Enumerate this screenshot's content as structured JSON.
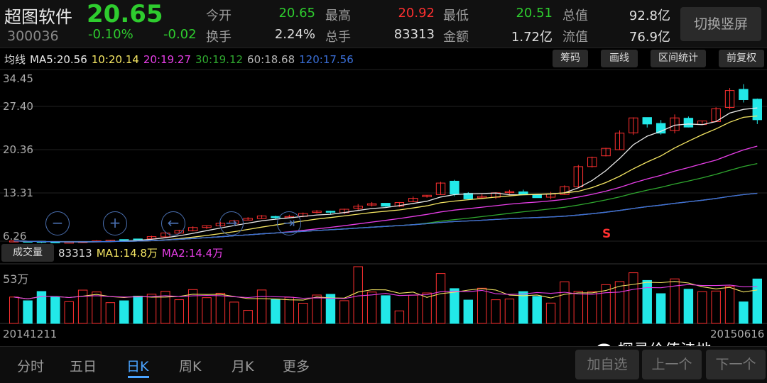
{
  "header": {
    "name": "超图软件",
    "price": "20.65",
    "code": "300036",
    "change_pct": "-0.10%",
    "change": "-0.02",
    "switch_label": "切换竖屏",
    "stats": [
      {
        "label": "今开",
        "value": "20.65",
        "color": "#2ecc2e"
      },
      {
        "label": "换手",
        "value": "2.24%",
        "color": "#e0e0e0"
      },
      {
        "label": "最高",
        "value": "20.92",
        "color": "#ff3030"
      },
      {
        "label": "总手",
        "value": "83313",
        "color": "#e0e0e0"
      },
      {
        "label": "最低",
        "value": "20.51",
        "color": "#2ecc2e"
      },
      {
        "label": "金额",
        "value": "1.72亿",
        "color": "#e0e0e0"
      },
      {
        "label": "总值",
        "value": "92.8亿",
        "color": "#e0e0e0"
      },
      {
        "label": "流值",
        "value": "76.9亿",
        "color": "#e0e0e0"
      }
    ]
  },
  "ma_legend": {
    "title": "均线",
    "items": [
      {
        "text": "MA5:20.56",
        "color": "#e8e8e8"
      },
      {
        "text": "10:20.14",
        "color": "#f5e663"
      },
      {
        "text": "20:19.27",
        "color": "#e83ee8"
      },
      {
        "text": "30:19.12",
        "color": "#2fa82f"
      },
      {
        "text": "60:18.68",
        "color": "#b5b5b5"
      },
      {
        "text": "120:17.56",
        "color": "#3a6fd8"
      }
    ]
  },
  "tools": [
    "筹码",
    "画线",
    "区间统计",
    "前复权"
  ],
  "price_axis": [
    "34.45",
    "27.40",
    "20.36",
    "13.31",
    "6.26"
  ],
  "volume": {
    "tag": "成交量",
    "total": "83313",
    "ma1": "MA1:14.8万",
    "ma2": "MA2:14.4万",
    "axis_max": "53万"
  },
  "dates": {
    "start": "20141211",
    "end": "20150616"
  },
  "sell_marker": "S",
  "watermark": "探寻价值洼地",
  "nav_tabs": [
    {
      "label": "分时",
      "active": false
    },
    {
      "label": "五日",
      "active": false
    },
    {
      "label": "日K",
      "active": true
    },
    {
      "label": "周K",
      "active": false
    },
    {
      "label": "月K",
      "active": false
    },
    {
      "label": "更多",
      "active": false
    }
  ],
  "actions": [
    "加自选",
    "上一个",
    "下一个"
  ],
  "colors": {
    "up": "#ff3030",
    "down": "#22e8e8",
    "accent": "#4aa3ff"
  },
  "chart_data": {
    "type": "candlestick",
    "x_range": [
      "20141211",
      "20150616"
    ],
    "ylim": [
      6.26,
      34.45
    ],
    "volume_max_label": "53万",
    "close_approx": [
      6.3,
      6.2,
      6.1,
      6.0,
      6.1,
      6.2,
      6.3,
      6.4,
      6.5,
      6.6,
      7.0,
      7.6,
      8.0,
      8.5,
      8.8,
      9.2,
      9.6,
      10.0,
      10.4,
      10.1,
      10.3,
      10.8,
      11.2,
      11.0,
      11.5,
      12.0,
      12.4,
      12.0,
      12.6,
      13.3,
      13.8,
      15.8,
      14.0,
      13.2,
      13.6,
      14.2,
      14.4,
      14.0,
      13.4,
      14.0,
      15.2,
      18.5,
      20.0,
      21.5,
      24.0,
      26.5,
      25.5,
      24.0,
      26.5,
      25.0,
      26.0,
      28.0,
      31.0,
      29.5,
      26.2
    ]
  }
}
